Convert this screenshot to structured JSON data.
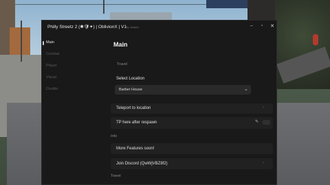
{
  "window": {
    "title": "Philly Streetz 2 (✱🛡✦) | OblivionX | V1",
    "subtitle": "By Joseph",
    "controls": {
      "minimize": "–",
      "maximize": "▫",
      "close": "✕"
    }
  },
  "sidebar": {
    "items": [
      {
        "label": "Main",
        "active": true
      },
      {
        "label": "Combat",
        "active": false
      },
      {
        "label": "Player",
        "active": false
      },
      {
        "label": "Visual",
        "active": false
      },
      {
        "label": "Credits",
        "active": false
      }
    ]
  },
  "main": {
    "title": "Main",
    "travel_section": "Travel",
    "select_location": {
      "label": "Select Location",
      "value": "Barber House"
    },
    "teleport_button": "Teleport to location",
    "tp_respawn_toggle": "TP here after respawn",
    "info_section": "Info",
    "more_features": "More Features soon!",
    "discord_button": "Join Discord (QwWjVBZ8f2)",
    "tweet_section": "Tweet"
  },
  "icons": {
    "chevron": "⌄",
    "arrow": "›",
    "pencil": "✎"
  },
  "colors": {
    "window_bg": "#191919",
    "row_bg": "#212121",
    "text_primary": "#e0e0e0",
    "text_muted": "#595959"
  }
}
